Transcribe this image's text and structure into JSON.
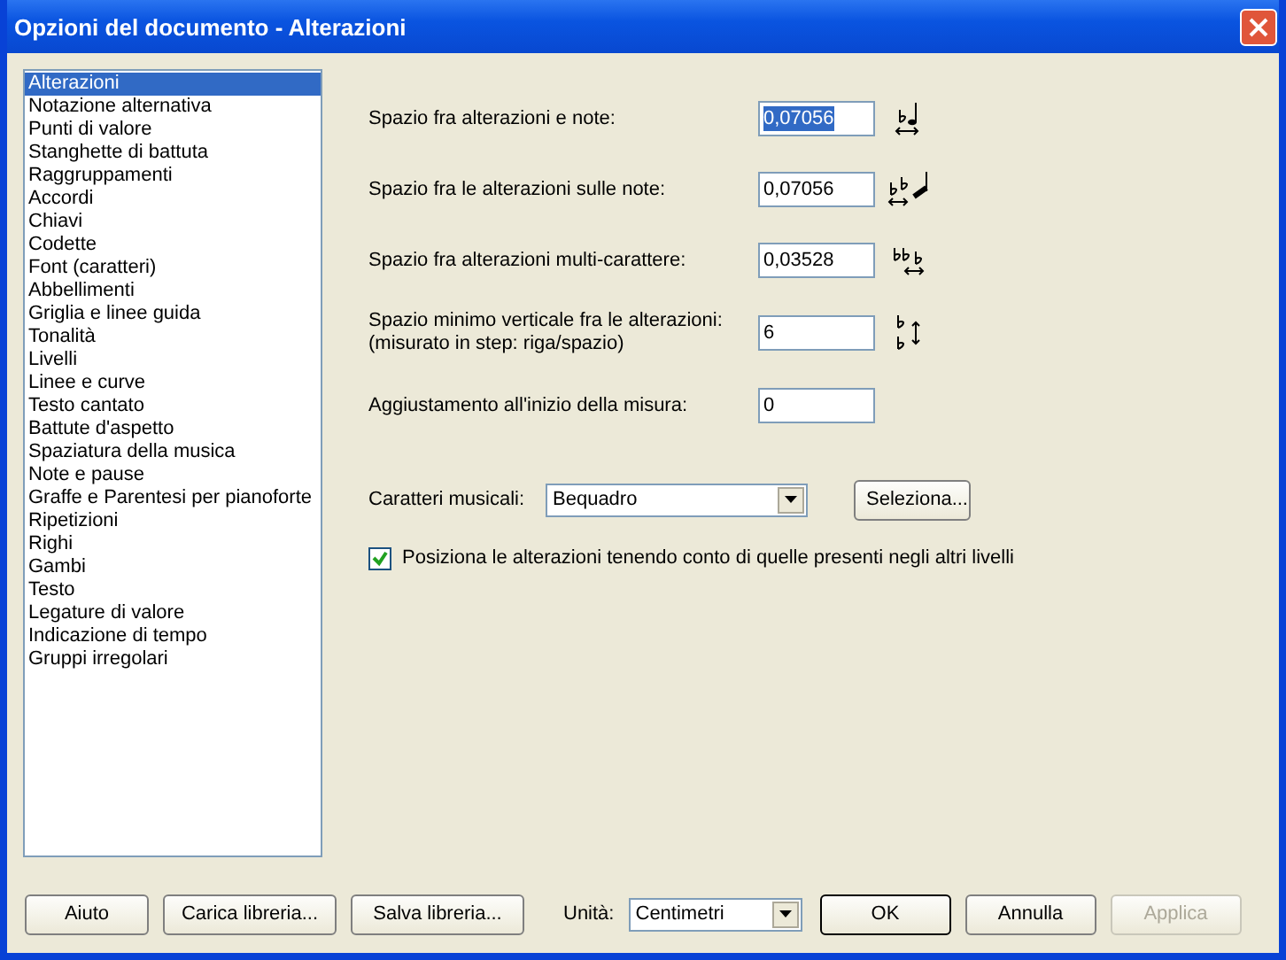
{
  "window": {
    "title": "Opzioni del documento - Alterazioni"
  },
  "categories": [
    {
      "label": "Alterazioni",
      "selected": true
    },
    {
      "label": "Notazione alternativa",
      "selected": false
    },
    {
      "label": "Punti di valore",
      "selected": false
    },
    {
      "label": "Stanghette di battuta",
      "selected": false
    },
    {
      "label": "Raggruppamenti",
      "selected": false
    },
    {
      "label": "Accordi",
      "selected": false
    },
    {
      "label": "Chiavi",
      "selected": false
    },
    {
      "label": "Codette",
      "selected": false
    },
    {
      "label": "Font (caratteri)",
      "selected": false
    },
    {
      "label": "Abbellimenti",
      "selected": false
    },
    {
      "label": "Griglia e linee guida",
      "selected": false
    },
    {
      "label": "Tonalità",
      "selected": false
    },
    {
      "label": "Livelli",
      "selected": false
    },
    {
      "label": "Linee e curve",
      "selected": false
    },
    {
      "label": "Testo cantato",
      "selected": false
    },
    {
      "label": "Battute d'aspetto",
      "selected": false
    },
    {
      "label": "Spaziatura della musica",
      "selected": false
    },
    {
      "label": "Note e pause",
      "selected": false
    },
    {
      "label": "Graffe e Parentesi per pianoforte",
      "selected": false
    },
    {
      "label": "Ripetizioni",
      "selected": false
    },
    {
      "label": "Righi",
      "selected": false
    },
    {
      "label": "Gambi",
      "selected": false
    },
    {
      "label": "Testo",
      "selected": false
    },
    {
      "label": "Legature di valore",
      "selected": false
    },
    {
      "label": "Indicazione di tempo",
      "selected": false
    },
    {
      "label": "Gruppi irregolari",
      "selected": false
    }
  ],
  "fields": [
    {
      "label": "Spazio fra alterazioni e note:",
      "value": "0,07056",
      "selected": true
    },
    {
      "label": "Spazio fra le alterazioni sulle note:",
      "value": "0,07056",
      "selected": false
    },
    {
      "label": "Spazio fra alterazioni multi-carattere:",
      "value": "0,03528",
      "selected": false
    },
    {
      "label": "Spazio minimo verticale fra le alterazioni:",
      "sublabel": "(misurato in step: riga/spazio)",
      "value": "6",
      "selected": false
    },
    {
      "label": "Aggiustamento all'inizio della misura:",
      "value": "0",
      "selected": false
    }
  ],
  "music_font": {
    "label": "Caratteri musicali:",
    "value": "Bequadro",
    "button": "Seleziona..."
  },
  "option": {
    "label": "Posiziona le alterazioni tenendo conto di quelle presenti negli altri livelli",
    "checked": true
  },
  "footer": {
    "buttons": [
      {
        "label": "Aiuto",
        "disabled": false
      },
      {
        "label": "Carica libreria...",
        "disabled": false
      },
      {
        "label": "Salva libreria...",
        "disabled": false
      }
    ],
    "unit_label": "Unità:",
    "unit_value": "Centimetri",
    "actions": [
      {
        "label": "OK",
        "default": true,
        "disabled": false
      },
      {
        "label": "Annulla",
        "default": false,
        "disabled": false
      },
      {
        "label": "Applica",
        "default": false,
        "disabled": true
      }
    ]
  }
}
